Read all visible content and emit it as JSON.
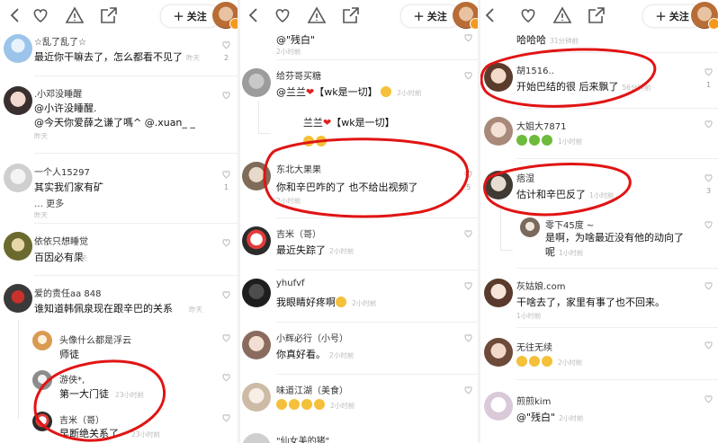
{
  "ui": {
    "follow": "关注"
  },
  "p1": {
    "c1": {
      "name": "☆乱了乱了☆",
      "text": "最近你干嘛去了，怎么都看不见了",
      "time": "昨天",
      "likes": "2"
    },
    "c2": {
      "name": ".小邓没睡醒",
      "line1": "@小许没睡醒.",
      "line2": "@今天你爱薛之谦了嗎^ @.xuan_ _",
      "time": "昨天"
    },
    "c3": {
      "name": "一个人15297",
      "text": "其实我们家有矿",
      "more": "… 更多",
      "time": "昨天",
      "likes": "1"
    },
    "c4": {
      "name": "依依只想睡觉",
      "text": "百因必有果",
      "time": "昨天"
    },
    "c5": {
      "name": "爱的责任aa 848",
      "text": "谁知道韩佩泉现在跟辛巴的关系",
      "time": "昨天"
    },
    "r1": {
      "name": "头像什么都是浮云",
      "text": "师徒"
    },
    "r2": {
      "name": "游侠*,",
      "text": "第一大门徒",
      "time": "23小时前"
    },
    "r3": {
      "name": "吉米（哥）",
      "text": "早断绝关系了",
      "time": "23小时前"
    }
  },
  "p2": {
    "c0": {
      "text": "@\"残白\"",
      "time": "2小时前"
    },
    "c1": {
      "name": "给芬哥买糖",
      "text": "@兰兰",
      "tag": "【wk是一切】",
      "time": "2小时前"
    },
    "r1": {
      "name": "兰兰",
      "text": "【wk是一切】"
    },
    "c2": {
      "name": "东北大果果",
      "text": "你和辛巴咋的了 也不给出视频了",
      "time": "2小时前",
      "likes": "5"
    },
    "c3": {
      "name": "吉米（哥）",
      "text": "最近失踪了",
      "time": "2小时前"
    },
    "c4": {
      "name": "yhufvf",
      "text": "我眼睛好疼啊",
      "time": "2小时前"
    },
    "c5": {
      "name": "小辉必行（小号）",
      "text": "你真好看。",
      "time": "2小时前"
    },
    "c6": {
      "name": "味道江湖（美食）",
      "time": "2小时前"
    },
    "c7": {
      "name": "\"仙女美的猪\""
    }
  },
  "p3": {
    "c0": {
      "text": "哈哈哈",
      "time": "31分钟前"
    },
    "c1": {
      "name": "胡1516..",
      "text": "开始巴结的很  后来飘了",
      "time": "56分钟前",
      "likes": "1"
    },
    "c2": {
      "name": "大姐大7871",
      "time": "1小时前"
    },
    "c3": {
      "name": "痞湿",
      "text": "估计和辛巴反了",
      "time": "1小时前",
      "likes": "3"
    },
    "r1": {
      "name": "零下45度 ~",
      "line1": "是啊，为啥最近没有他的动向了",
      "line2": "呢",
      "time": "1小时前"
    },
    "c4": {
      "name": "灰姑娘.com",
      "text": "干啥去了，家里有事了也不回来。",
      "time": "1小时前"
    },
    "c5": {
      "name": "无往无续",
      "time": "2小时前"
    },
    "c6": {
      "name": "煎煎kim",
      "text": "@\"残白\"",
      "time": "2小时前"
    }
  }
}
